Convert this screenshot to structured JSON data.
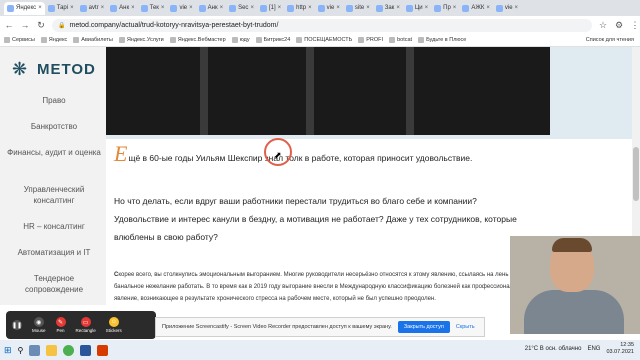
{
  "browser": {
    "tabs": [
      {
        "label": "Яндекс"
      },
      {
        "label": "Тарі"
      },
      {
        "label": "avtr"
      },
      {
        "label": "Анк"
      },
      {
        "label": "Тек"
      },
      {
        "label": "vie"
      },
      {
        "label": "Анк"
      },
      {
        "label": "Sec"
      },
      {
        "label": "[1]"
      },
      {
        "label": "http"
      },
      {
        "label": "vie"
      },
      {
        "label": "site"
      },
      {
        "label": "Зак"
      },
      {
        "label": "Ци"
      },
      {
        "label": "Пр"
      },
      {
        "label": "АЖК"
      },
      {
        "label": "vie"
      }
    ],
    "url": "metod.company/actual/trud-kotoryy-nravitsya-perestaet-byt-trudom/",
    "bookmarks": [
      "Сервисы",
      "Яндекс",
      "Авиабилеты",
      "Яндекс.Услуги",
      "Яндекс.Вебмастер",
      "юду",
      "Битрикс24",
      "ПОСЕЩАЕМОСТЬ",
      "PROFI",
      "botcat",
      "Будьте в Плюсе"
    ],
    "reading_list": "Список для чтения"
  },
  "sidebar": {
    "logo_text": "METOD",
    "items": [
      {
        "label": "Право"
      },
      {
        "label": "Банкротство"
      },
      {
        "label": "Финансы, аудит и оценка"
      },
      {
        "label": "Управленческий консалтинг"
      },
      {
        "label": "HR – консалтинг"
      },
      {
        "label": "Автоматизация и IT"
      },
      {
        "label": "Тендерное сопровождение"
      }
    ]
  },
  "article": {
    "dropcap": "Е",
    "para1": "щё в 60-ые годы Уильям Шекспир знал толк в работе, которая приносит удовольствие.",
    "para2": "Но что делать, если вдруг ваши работники перестали трудиться во благо себе и компании? Удовольствие и интерес канули в бездну, а мотивация не работает? Даже у тех сотрудников, которые влюблены в свою работу?",
    "para3_lead": "С",
    "para3": "корее всего, вы столкнулись эмоциональным выгоранием. Многие руководители несерьёзно относятся к этому явлению, ссылаясь на лень и банальное нежелание работать. В то время как в 2019 году выгорание внесли в Международную классификацию болезней как профессиональное явление, возникающее в результате хронического стресса на рабочем месте, который не был успешно преодолен."
  },
  "screencastify": {
    "tools": [
      {
        "label": "Mouse"
      },
      {
        "label": "Pen"
      },
      {
        "label": "Rectangle"
      },
      {
        "label": "Stickers"
      }
    ],
    "notification": "Приложение Screencastify - Screen Video Recorder предоставлен доступ к вашему экрану.",
    "share_label": "Закрыть доступ",
    "hide_label": "Скрыть"
  },
  "taskbar": {
    "weather": "21°C  В осн. облачно",
    "lang": "ENG",
    "time": "12:35",
    "date": "03.07.2021"
  }
}
